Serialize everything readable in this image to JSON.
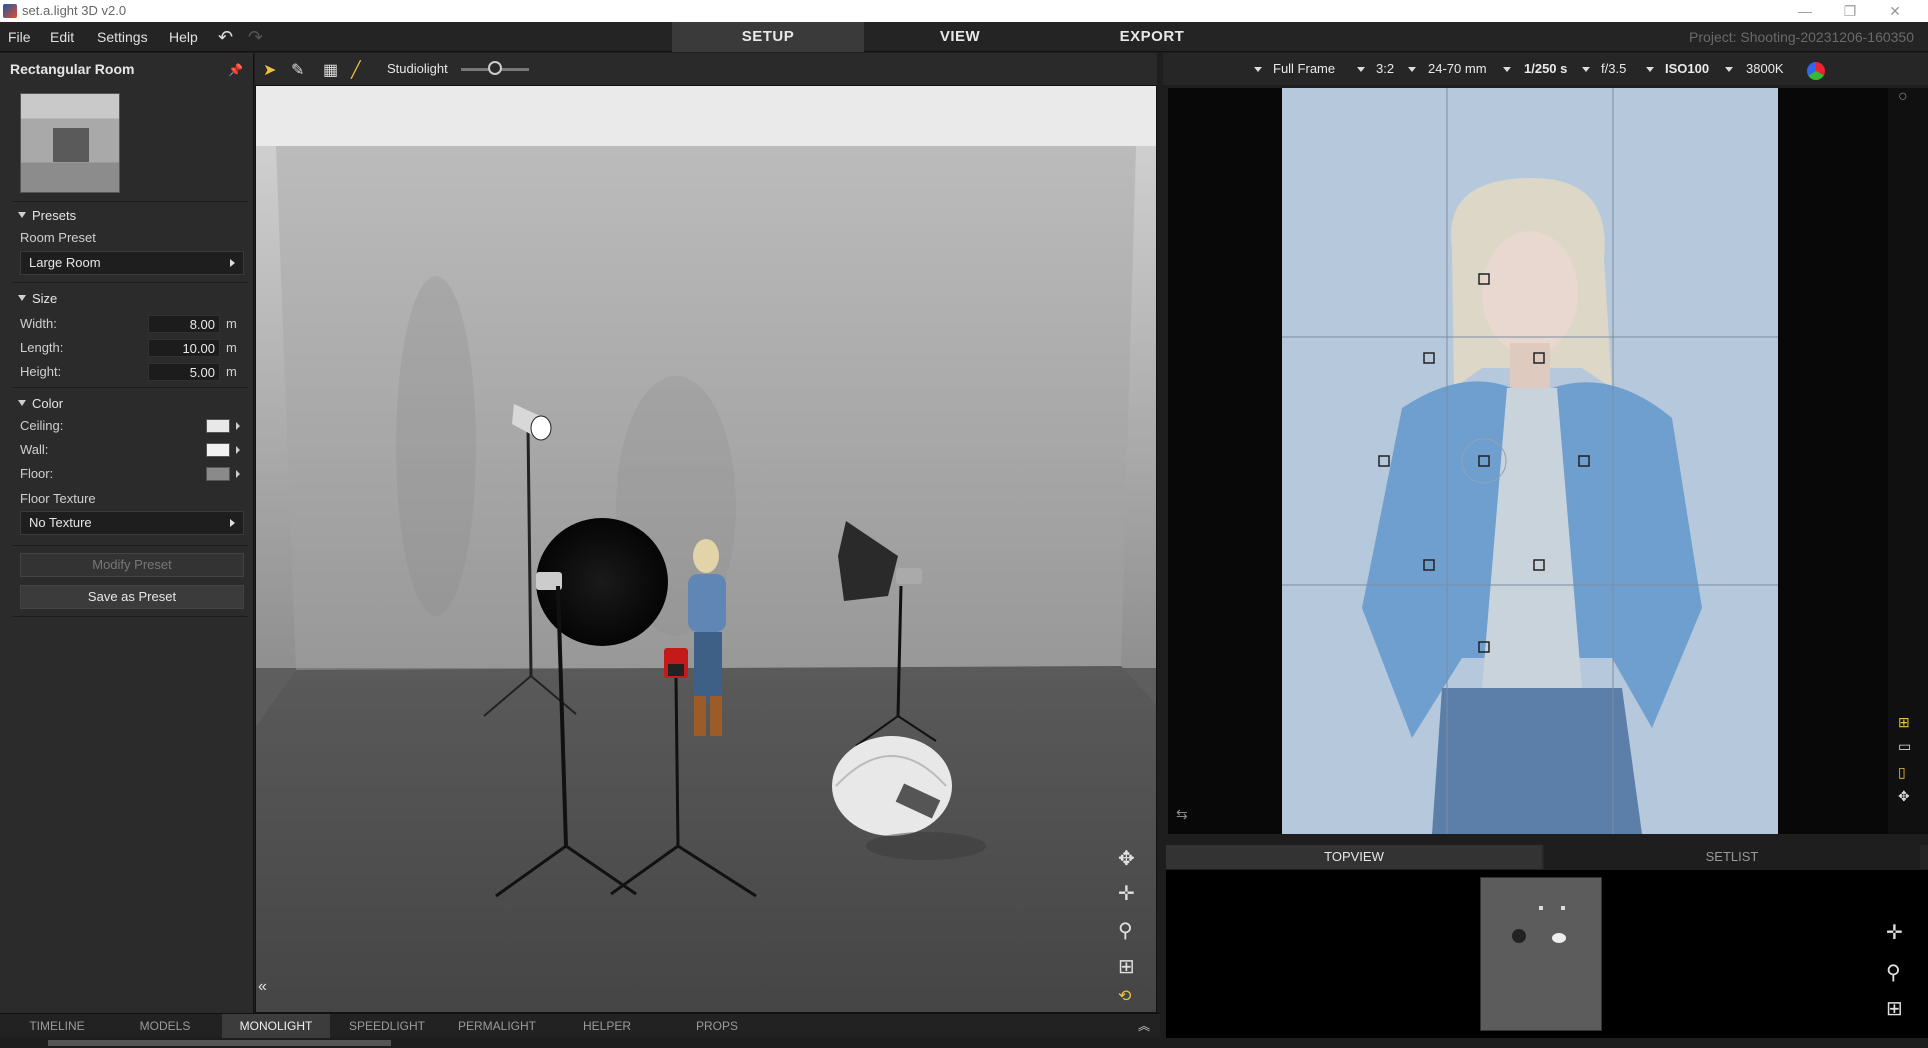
{
  "window": {
    "title": "set.a.light 3D v2.0"
  },
  "menu": {
    "items": [
      "File",
      "Edit",
      "Settings",
      "Help"
    ]
  },
  "modes": {
    "tabs": [
      "SETUP",
      "VIEW",
      "EXPORT"
    ],
    "active": "SETUP"
  },
  "project": {
    "title": "Project: Shooting-20231206-160350"
  },
  "room_panel": {
    "header": "Rectangular Room",
    "presets": {
      "section": "Presets",
      "room_preset_label": "Room Preset",
      "room_preset_value": "Large Room"
    },
    "size": {
      "section": "Size",
      "width_label": "Width:",
      "width_value": "8.00",
      "length_label": "Length:",
      "length_value": "10.00",
      "height_label": "Height:",
      "height_value": "5.00",
      "unit": "m"
    },
    "color": {
      "section": "Color",
      "ceiling_label": "Ceiling:",
      "ceiling_color": "#e8e8e8",
      "wall_label": "Wall:",
      "wall_color": "#f2f2f2",
      "floor_label": "Floor:",
      "floor_color": "#8a8a8a",
      "floor_texture_label": "Floor Texture",
      "floor_texture_value": "No Texture"
    },
    "buttons": {
      "modify_preset": "Modify Preset",
      "save_as_preset": "Save as Preset"
    }
  },
  "viewport_toolbar": {
    "studiolight_label": "Studiolight",
    "studiolight_level": 0.5
  },
  "camera_settings": {
    "sensor": "Full Frame",
    "aspect": "3:2",
    "lens": "24-70 mm",
    "shutter": "1/250 s",
    "aperture": "f/3.5",
    "iso": "ISO100",
    "white_balance": "3800K"
  },
  "bottom_right_tabs": [
    "TOPVIEW",
    "SETLIST"
  ],
  "library_tabs": {
    "items": [
      "TIMELINE",
      "MODELS",
      "MONOLIGHT",
      "SPEEDLIGHT",
      "PERMALIGHT",
      "HELPER",
      "PROPS"
    ],
    "active": "MONOLIGHT"
  }
}
